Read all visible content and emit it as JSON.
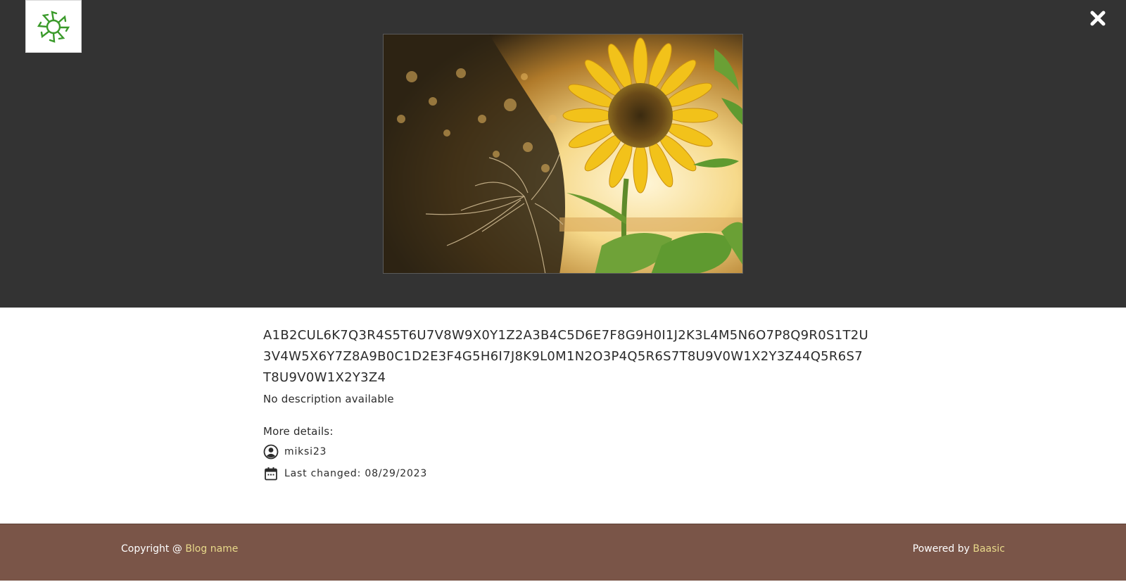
{
  "viewer": {
    "logo_icon": "sunburst-logo-icon",
    "close_icon": "close-icon",
    "photo_alt": "sunflower-photo"
  },
  "post": {
    "title": "A1B2CUL6K7Q3R4S5T6U7V8W9X0Y1Z2A3B4C5D6E7F8G9H0I1J2K3L4M5N6O7P8Q9R0S1T2U3V4W5X6Y7Z8A9B0C1D2E3F4G5H6I7J8K9L0M1N2O3P4Q5R6S7T8U9V0W1X2Y3Z44Q5R6S7T8U9V0W1X2Y3Z4",
    "description": "No description available",
    "more_details_label": "More details:",
    "author": "miksi23",
    "last_changed": "Last changed: 08/29/2023"
  },
  "footer": {
    "copyright_prefix": "Copyright @ ",
    "blog_name": "Blog name",
    "powered_prefix": "Powered by ",
    "powered_name": "Baasic",
    "link_color": "#e8d98a",
    "background": "#7a5548"
  }
}
